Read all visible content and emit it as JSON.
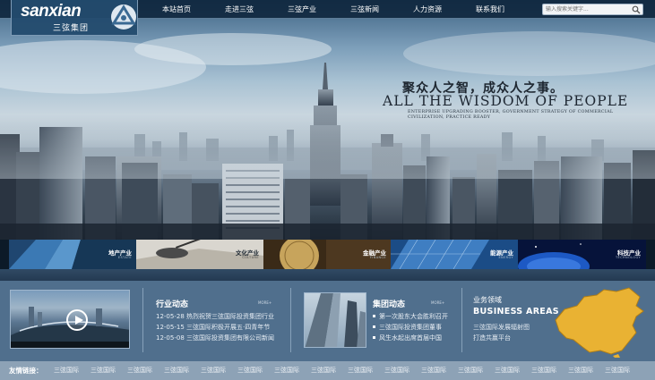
{
  "brand": {
    "logo_text": "sanxian",
    "logo_sub": "三弦集团"
  },
  "nav": [
    "本站首页",
    "走进三弦",
    "三弦产业",
    "三弦新闻",
    "人力资源",
    "联系我们"
  ],
  "search": {
    "placeholder": "输入搜索关键字..."
  },
  "hero": {
    "slogan_cn": "聚众人之智，成众人之事。",
    "slogan_en": "ALL THE WISDOM OF PEOPLE",
    "slogan_sub1": "ENTERPRISE UPGRADING BOOSTER, GOVERNMENT STRATEGY OF COMMERCIAL",
    "slogan_sub2": "CIVILIZATION, PRACTICE READY"
  },
  "categories": [
    {
      "cn": "地产产业",
      "en": "ESTATE"
    },
    {
      "cn": "文化产业",
      "en": "CULTURE"
    },
    {
      "cn": "金融产业",
      "en": "FINANCE"
    },
    {
      "cn": "能源产业",
      "en": "ENERGY"
    },
    {
      "cn": "科技产业",
      "en": "TECHNOLOGY"
    }
  ],
  "industry_news": {
    "title": "行业动态",
    "more": "MORE+",
    "items": [
      {
        "date": "12-05-28",
        "text": "热烈祝贺三弦国际投资集团行业"
      },
      {
        "date": "12-05-15",
        "text": "三弦国际积极开展五·四青年节"
      },
      {
        "date": "12-05-08",
        "text": "三弦国际投资集团有限公司新闻"
      }
    ]
  },
  "group_news": {
    "title": "集团动态",
    "more": "MORE+",
    "items": [
      "第一次股东大会胜利召开",
      "三弦国际投资集团董事",
      "风生水起出席首届中国"
    ]
  },
  "business": {
    "title_cn": "业务领域",
    "title_en": "BUSINESS AREAS",
    "line1": "三弦国际发展辐射图",
    "line2": "打造共赢平台"
  },
  "footer": {
    "label": "友情链接：",
    "links": [
      "三弦国际",
      "三弦国际",
      "三弦国际",
      "三弦国际",
      "三弦国际",
      "三弦国际",
      "三弦国际",
      "三弦国际",
      "三弦国际",
      "三弦国际",
      "三弦国际",
      "三弦国际",
      "三弦国际",
      "三弦国际",
      "三弦国际",
      "三弦国际"
    ]
  }
}
